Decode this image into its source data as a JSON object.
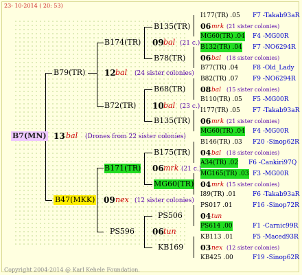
{
  "header": {
    "date": "23- 10-2014 ( 20: 53)"
  },
  "footer": {
    "copyright": "Copyright 2004-2014 @ Karl Kehele Foundation."
  },
  "root": {
    "name": "B7(MN)",
    "count": "13",
    "origin": "bal",
    "note": "(Drones from 22 sister colonies)"
  },
  "gen2": {
    "upper": {
      "name": "B79(TR)",
      "count": "12",
      "origin": "bal",
      "note": "(24 sister colonies)"
    },
    "lower": {
      "name": "B47(MKK)",
      "count": "09",
      "origin": "nex",
      "note": "(12 sister colonies)"
    }
  },
  "gen3": {
    "b174": {
      "name": "B174(TR)",
      "count": "09",
      "origin": "bal",
      "note": "(21 c.)"
    },
    "b72": {
      "name": "B72(TR)",
      "count": "10",
      "origin": "bal",
      "note": "(23 c.)"
    },
    "b171": {
      "name": "B171(TR)",
      "count": "06",
      "origin": "mrk",
      "note": "(21 c.)"
    },
    "ps596": {
      "name": "PS596",
      "count": "06",
      "origin": "tun"
    }
  },
  "gen4": {
    "b135a": "B135(TR)",
    "b78": "B78(TR)",
    "b68": "B68(TR)",
    "b135b": "B135(TR)",
    "b175": "B175(TR)",
    "mg60": "MG60(TR)",
    "ps506": "PS506",
    "kb169": "KB169"
  },
  "gen5": [
    {
      "name": "I177(TR) .05",
      "ref": "F7 -Takab93aR"
    },
    {
      "count": "06",
      "origin": "mrk",
      "note": "(21 sister colonies)"
    },
    {
      "name": "MG60(TR) .04",
      "ref": "F4 -MG00R"
    },
    {
      "name": "B132(TR) .04",
      "ref": "F7 -NO6294R"
    },
    {
      "count": "06",
      "origin": "bal",
      "note": "(18 sister colonies)"
    },
    {
      "name": "B77(TR) .04",
      "ref": "F8 -Old_Lady"
    },
    {
      "name": "B82(TR) .07",
      "ref": "F9 -NO6294R"
    },
    {
      "count": "08",
      "origin": "bal",
      "note": "(15 sister colonies)"
    },
    {
      "name": "B110(TR) .05",
      "ref": "F5 -MG00R"
    },
    {
      "name": "I177(TR) .05",
      "ref": "F7 -Takab93aR"
    },
    {
      "count": "06",
      "origin": "mrk",
      "note": "(21 sister colonies)"
    },
    {
      "name": "MG60(TR) .04",
      "ref": "F4 -MG00R"
    },
    {
      "name": "B146(TR) .03",
      "ref": "F20 -Sinop62R"
    },
    {
      "count": "04",
      "origin": "bal",
      "note": "(18 sister colonies)"
    },
    {
      "name": "A34(TR) .02",
      "ref": "F6 -Cankiri97Q"
    },
    {
      "name": "MG165(TR) .03",
      "ref": "F3 -MG00R"
    },
    {
      "count": "04",
      "origin": "mrk",
      "note": "(15 sister colonies)"
    },
    {
      "name": "I89(TR) .01",
      "ref": "F6 -Takab93aR"
    },
    {
      "name": "PS017 .01",
      "ref": "F16 -Sinop72R"
    },
    {
      "count": "04",
      "origin": "tun",
      "note": ""
    },
    {
      "name": "PS614 .00",
      "ref": "F1 -Carnic99R"
    },
    {
      "name": "KB113 .01",
      "ref": "F5 -Maced93R"
    },
    {
      "count": "03",
      "origin": "nex",
      "note": "(12 sister colonies)"
    },
    {
      "name": "KB425 .00",
      "ref": "F19 -Sinop62R"
    }
  ]
}
